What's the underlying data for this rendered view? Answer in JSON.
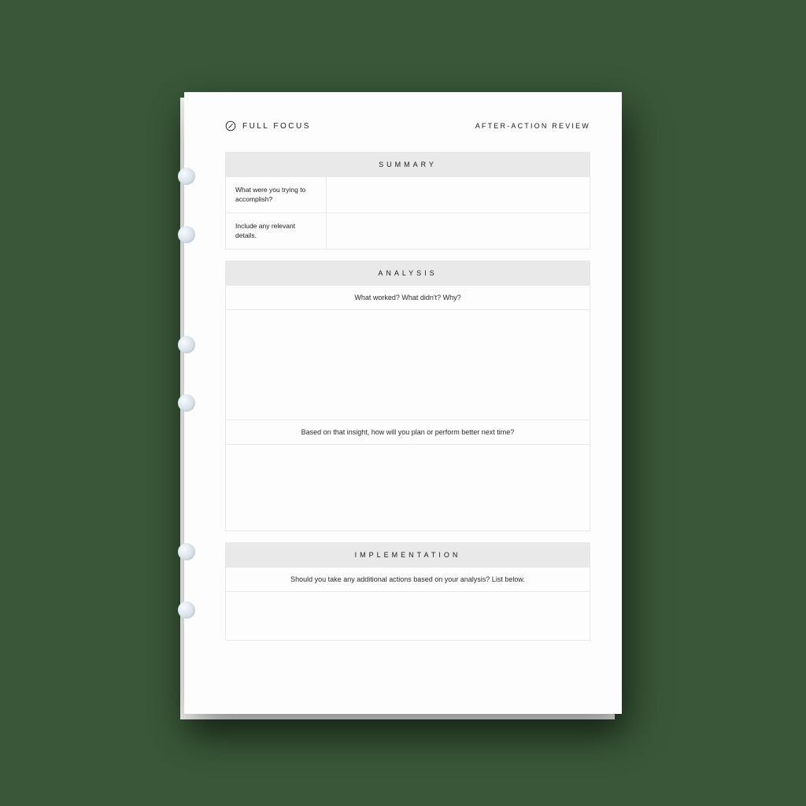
{
  "brand": {
    "name": "FULL FOCUS"
  },
  "page": {
    "title": "AFTER-ACTION REVIEW"
  },
  "sections": {
    "summary": {
      "heading": "SUMMARY",
      "rows": [
        {
          "label": "What were you trying to accomplish?"
        },
        {
          "label": "Include any relevant details."
        }
      ]
    },
    "analysis": {
      "heading": "ANALYSIS",
      "prompts": [
        "What worked? What didn't? Why?",
        "Based on that insight, how will you plan or perform better next time?"
      ]
    },
    "implementation": {
      "heading": "IMPLEMENTATION",
      "prompt": "Should you take any additional actions based on your analysis? List below."
    }
  }
}
